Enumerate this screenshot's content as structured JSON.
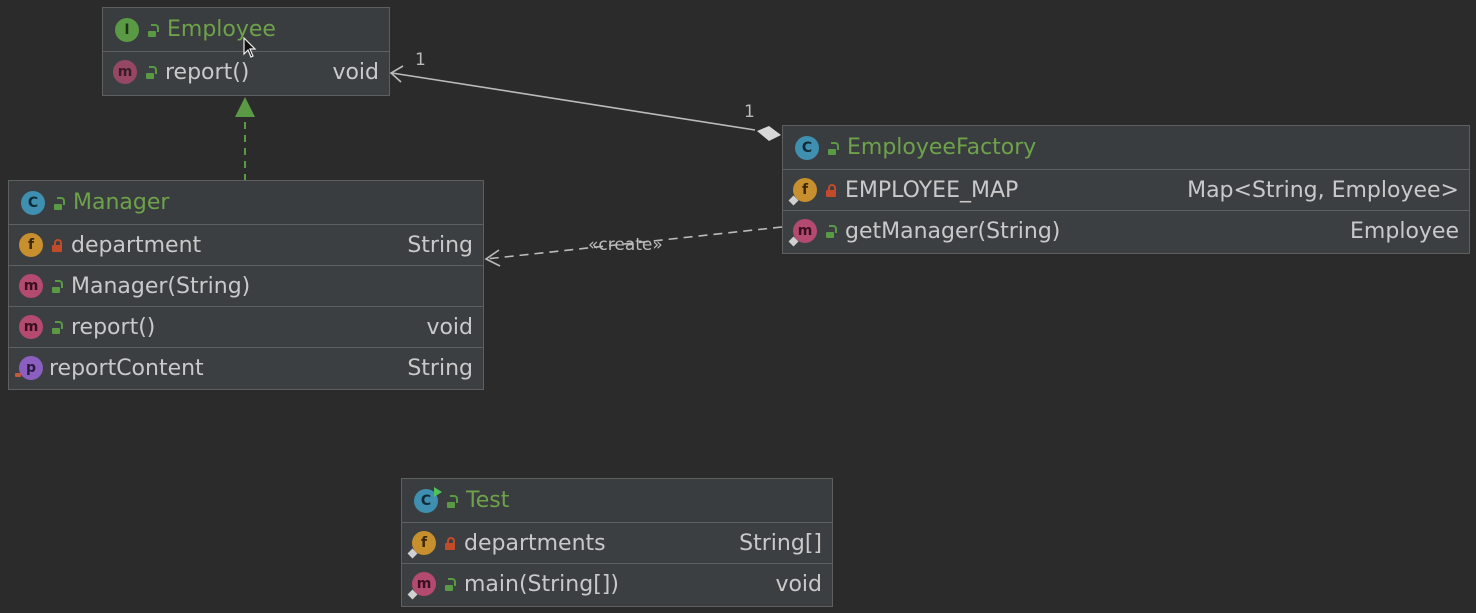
{
  "classes": {
    "employee": {
      "name": "Employee",
      "kind_icon": "I",
      "methods": [
        {
          "label": "report()",
          "type": "void"
        }
      ]
    },
    "manager": {
      "name": "Manager",
      "kind_icon": "C",
      "fields": [
        {
          "label": "department",
          "type": "String"
        }
      ],
      "constructors": [
        {
          "label": "Manager(String)"
        }
      ],
      "methods": [
        {
          "label": "report()",
          "type": "void"
        }
      ],
      "properties": [
        {
          "label": "reportContent",
          "type": "String"
        }
      ]
    },
    "employee_factory": {
      "name": "EmployeeFactory",
      "kind_icon": "C",
      "fields": [
        {
          "label": "EMPLOYEE_MAP",
          "type": "Map<String, Employee>"
        }
      ],
      "methods": [
        {
          "label": "getManager(String)",
          "type": "Employee"
        }
      ]
    },
    "test": {
      "name": "Test",
      "kind_icon": "C",
      "fields": [
        {
          "label": "departments",
          "type": "String[]"
        }
      ],
      "methods": [
        {
          "label": "main(String[])",
          "type": "void"
        }
      ]
    }
  },
  "icons": {
    "field_badge": "f",
    "method_badge": "m",
    "property_badge": "p"
  },
  "edges": {
    "aggregation": {
      "from_multiplicity": "1",
      "to_multiplicity": "1"
    },
    "create": {
      "label": "«create»"
    }
  },
  "colors": {
    "background": "#2b2b2b",
    "class_name": "#6ea24a",
    "text": "#c9c9c9",
    "edge": "#bbbbbb",
    "realization": "#5a9a45"
  }
}
